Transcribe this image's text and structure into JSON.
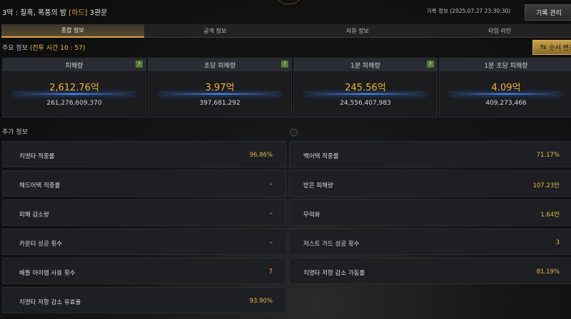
{
  "header": {
    "title_main": "3막 : 칠흑, 폭풍의 밤",
    "difficulty": "[하드]",
    "gate": "3관문",
    "record_info": "기록 정보 (2025.07.27 23:30:30)",
    "record_button": "기록 관리"
  },
  "tabs": [
    {
      "label": "종합 정보",
      "active": true
    },
    {
      "label": "공격 정보",
      "active": false
    },
    {
      "label": "지원 정보",
      "active": false
    },
    {
      "label": "타임 라인",
      "active": false
    }
  ],
  "main_info": {
    "label": "주요 정보",
    "battle_time": "(전투 시간 10 : 57)",
    "order_button": "순서 변경"
  },
  "cards": [
    {
      "title": "피해량",
      "value": "2,612.76억",
      "detail": "261,276,609,370",
      "help": "?"
    },
    {
      "title": "초당 피해량",
      "value": "3.97억",
      "detail": "397,681,292",
      "help": "?"
    },
    {
      "title": "1분 피해량",
      "value": "245.56억",
      "detail": "24,556,407,983",
      "help": "?"
    },
    {
      "title": "1분 초당 피해량",
      "value": "4.09억",
      "detail": "409,273,466",
      "help": ""
    }
  ],
  "extra_info": {
    "label": "추가 정보",
    "left_rows": [
      {
        "label": "치명타 적중률",
        "value": "96.86%"
      },
      {
        "label": "헤드어택 적중률",
        "value": "–"
      },
      {
        "label": "피해 감소량",
        "value": "–"
      },
      {
        "label": "카운터 성공 횟수",
        "value": "–"
      },
      {
        "label": "배틀 아이템 사용 횟수",
        "value": "7"
      },
      {
        "label": "치명타 저항 감소 유효율",
        "value": "93.90%"
      }
    ],
    "right_rows": [
      {
        "label": "백어택 적중률",
        "value": "71.17%"
      },
      {
        "label": "받은 피해량",
        "value": "107.23만"
      },
      {
        "label": "무력화",
        "value": "1.64만"
      },
      {
        "label": "저스트 가드 성공 횟수",
        "value": "3"
      },
      {
        "label": "치명타 저항 감소 가동률",
        "value": "81.19%"
      }
    ]
  },
  "colors": {
    "accent": "#e6b84a",
    "tab_active": "#d9a441",
    "glow": "#4a8cff"
  },
  "icons": {
    "order": "swap-icon",
    "help": "question-icon",
    "settings": "gear-icon"
  }
}
